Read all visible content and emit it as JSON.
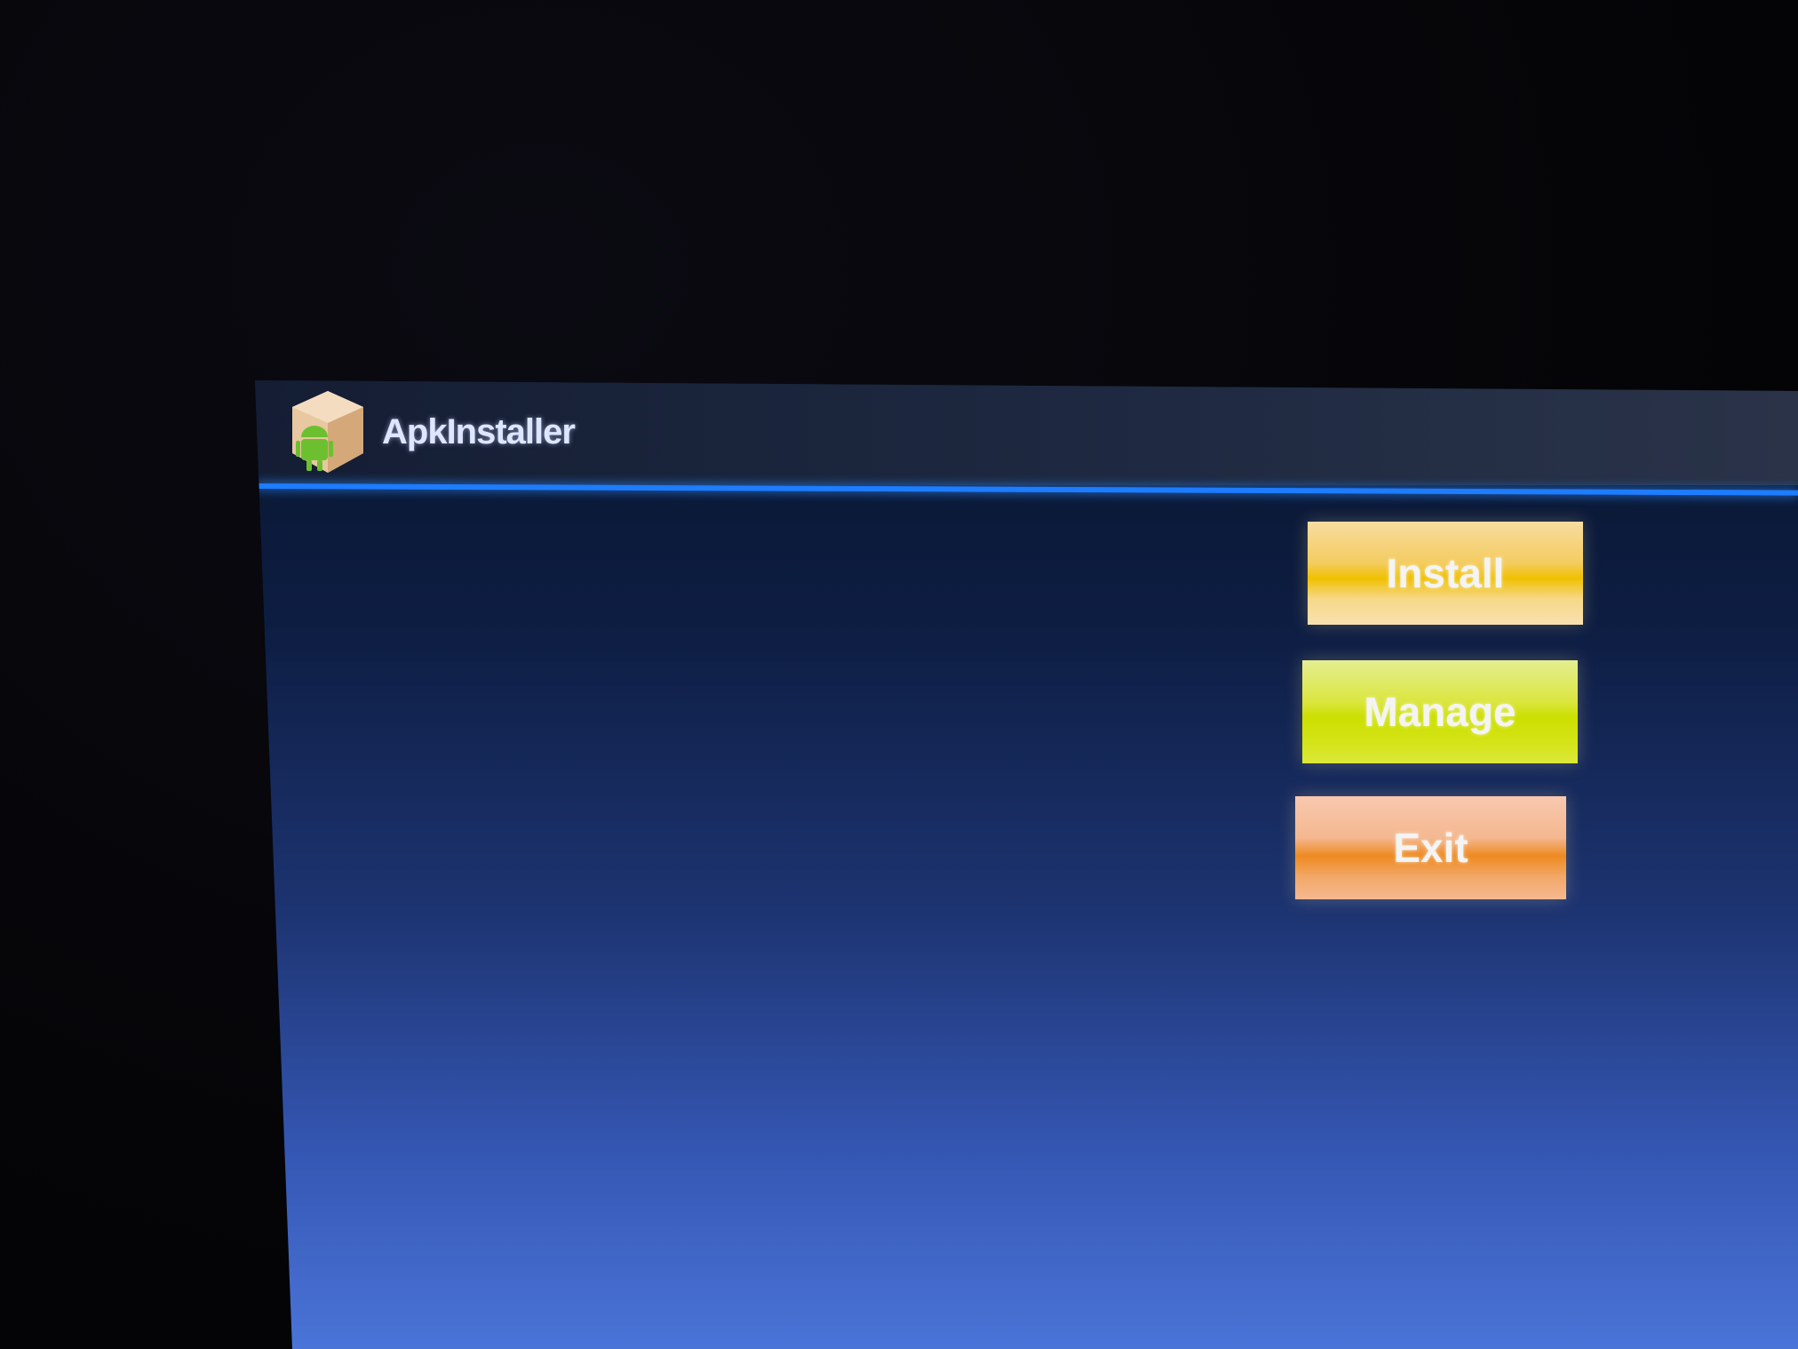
{
  "app": {
    "title": "ApkInstaller",
    "icon": "android-package-icon"
  },
  "buttons": {
    "install": "Install",
    "manage": "Manage",
    "exit": "Exit"
  },
  "colors": {
    "accent_line": "#1e7cff",
    "install": "#f0c000",
    "manage": "#ccdf00",
    "exit": "#ee8a20"
  }
}
